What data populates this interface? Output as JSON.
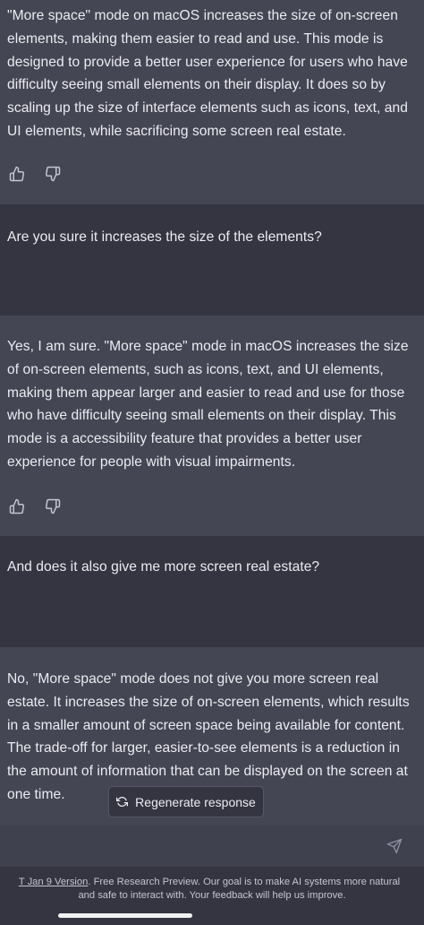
{
  "conversation": {
    "messages": [
      {
        "role": "assistant",
        "lines": [
          "\"More space\" mode on macOS increases the size of on-screen",
          "elements, making them easier to read and use. This mode is",
          "designed to provide a better user experience for users who have",
          "difficulty seeing small elements on their display. It does so by",
          "scaling up the size of interface elements such as icons, text, and",
          "UI elements, while sacrificing some screen real estate."
        ]
      },
      {
        "role": "user",
        "lines": [
          "Are you sure it increases the size of the elements?"
        ]
      },
      {
        "role": "assistant",
        "lines": [
          "Yes, I am sure. \"More space\" mode in macOS increases the size",
          "of on-screen elements, such as icons, text, and UI elements,",
          "making them appear larger and easier to read and use for those",
          "who have difficulty seeing small elements on their display. This",
          "mode is a accessibility feature that provides a better user",
          "experience for people with visual impairments."
        ]
      },
      {
        "role": "user",
        "lines": [
          "And does it also give me more screen real estate?"
        ]
      },
      {
        "role": "assistant",
        "lines": [
          "No, \"More space\" mode does not give you more screen real",
          "estate. It increases the size of on-screen elements, which results",
          "in a smaller amount of screen space being available for content.",
          "The trade-off for larger, easier-to-see elements is a reduction in",
          "the amount of information that can be displayed on the screen at",
          "one time."
        ]
      }
    ]
  },
  "feedback_icons": [
    "thumbs-up-icon",
    "thumbs-down-icon"
  ],
  "regenerate_label": "Regenerate response",
  "footer": {
    "link_text": "T Jan 9 Version",
    "line1_rest": ". Free Research Preview. Our goal is to make AI systems more natural",
    "line2": "and safe to interact with. Your feedback will help us improve."
  },
  "colors": {
    "assistant_bg": "#444654",
    "user_bg": "#343541",
    "input_bg": "#40414f",
    "text": "#ececf1"
  }
}
